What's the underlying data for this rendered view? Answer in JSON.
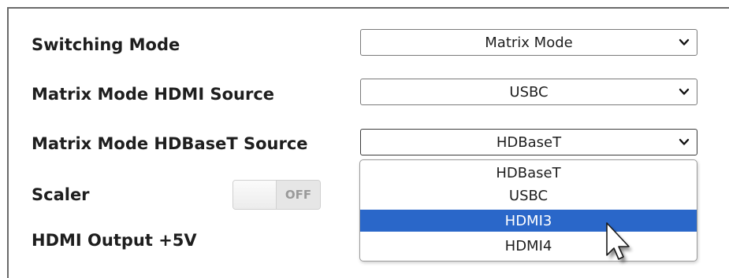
{
  "settings": {
    "switching_mode": {
      "label": "Switching Mode",
      "value": "Matrix Mode"
    },
    "hdmi_source": {
      "label": "Matrix Mode HDMI Source",
      "value": "USBC"
    },
    "hdbaset_source": {
      "label": "Matrix Mode HDBaseT Source",
      "value": "HDBaseT"
    },
    "scaler": {
      "label": "Scaler",
      "state": "OFF"
    },
    "hdmi_output_5v": {
      "label": "HDMI Output +5V"
    }
  },
  "dropdown": {
    "options": [
      "HDBaseT",
      "USBC",
      "HDMI3",
      "HDMI4"
    ],
    "highlighted": "HDMI3",
    "highlight_color": "#2a67c9"
  },
  "icons": {
    "select_arrow": "chevron-down-icon",
    "cursor": "mouse-pointer-icon"
  }
}
